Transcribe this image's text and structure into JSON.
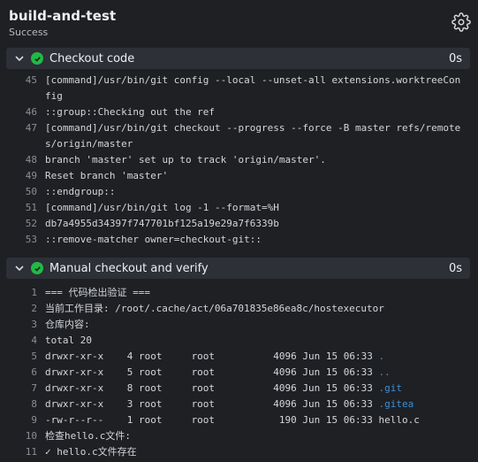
{
  "job": {
    "title": "build-and-test",
    "status": "Success"
  },
  "steps": [
    {
      "name": "Checkout code",
      "duration": "0s",
      "lines": [
        {
          "n": "45",
          "text": "[command]/usr/bin/git config --local --unset-all extensions.worktreeConfig"
        },
        {
          "n": "46",
          "text": "::group::Checking out the ref"
        },
        {
          "n": "47",
          "text": "[command]/usr/bin/git checkout --progress --force -B master refs/remotes/origin/master"
        },
        {
          "n": "48",
          "text": "branch 'master' set up to track 'origin/master'."
        },
        {
          "n": "49",
          "text": "Reset branch 'master'"
        },
        {
          "n": "50",
          "text": "::endgroup::"
        },
        {
          "n": "51",
          "text": "[command]/usr/bin/git log -1 --format=%H"
        },
        {
          "n": "52",
          "text": "db7a4955d34397f747701bf125a19e29a7f6339b"
        },
        {
          "n": "53",
          "text": "::remove-matcher owner=checkout-git::"
        }
      ]
    },
    {
      "name": "Manual checkout and verify",
      "duration": "0s",
      "lines": [
        {
          "n": "1",
          "text": "=== 代码检出验证 ==="
        },
        {
          "n": "2",
          "text": "当前工作目录: /root/.cache/act/06a701835e86ea8c/hostexecutor"
        },
        {
          "n": "3",
          "text": "仓库内容:"
        },
        {
          "n": "4",
          "text": "total 20"
        },
        {
          "n": "5",
          "text": "drwxr-xr-x    4 root     root          4096 Jun 15 06:33 ",
          "link": "."
        },
        {
          "n": "6",
          "text": "drwxr-xr-x    5 root     root          4096 Jun 15 06:33 ",
          "link": ".."
        },
        {
          "n": "7",
          "text": "drwxr-xr-x    8 root     root          4096 Jun 15 06:33 ",
          "link": ".git"
        },
        {
          "n": "8",
          "text": "drwxr-xr-x    3 root     root          4096 Jun 15 06:33 ",
          "link": ".gitea"
        },
        {
          "n": "9",
          "text": "-rw-r--r--    1 root     root           190 Jun 15 06:33 hello.c"
        },
        {
          "n": "10",
          "text": "检查hello.c文件:"
        },
        {
          "n": "11",
          "text": "✓ hello.c文件存在"
        }
      ]
    }
  ]
}
